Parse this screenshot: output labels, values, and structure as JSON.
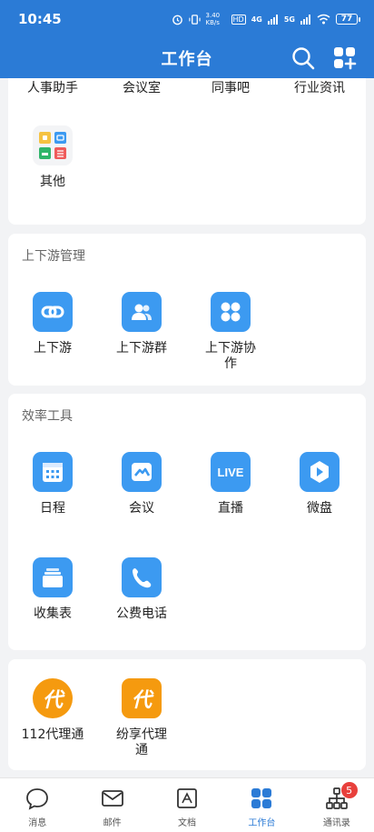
{
  "status_bar": {
    "time": "10:45",
    "net_speed": "3.40 KB/s",
    "hd": "HD",
    "net_4g": "4G",
    "net_5g": "5G",
    "battery": "77"
  },
  "header": {
    "title": "工作台"
  },
  "top_row": [
    "人事助手",
    "会议室",
    "同事吧",
    "行业资讯"
  ],
  "other_card": {
    "app_label": "其他"
  },
  "sections": {
    "updown": {
      "title": "上下游管理",
      "apps": [
        "上下游",
        "上下游群",
        "上下游协\n作"
      ]
    },
    "efficiency": {
      "title": "效率工具",
      "apps": [
        "日程",
        "会议",
        "直播",
        "微盘",
        "收集表",
        "公费电话"
      ],
      "live_text": "LIVE"
    },
    "agent": {
      "apps": [
        "112代理通",
        "纷享代理\n通"
      ],
      "icon_glyph": "代"
    }
  },
  "tabbar": {
    "tabs": [
      "消息",
      "邮件",
      "文档",
      "工作台",
      "通讯录"
    ],
    "contacts_badge": "5"
  },
  "colors": {
    "brand": "#2b7bd6",
    "app_blue": "#3c9af1",
    "app_orange": "#f59a0f",
    "badge": "#e8403c"
  }
}
